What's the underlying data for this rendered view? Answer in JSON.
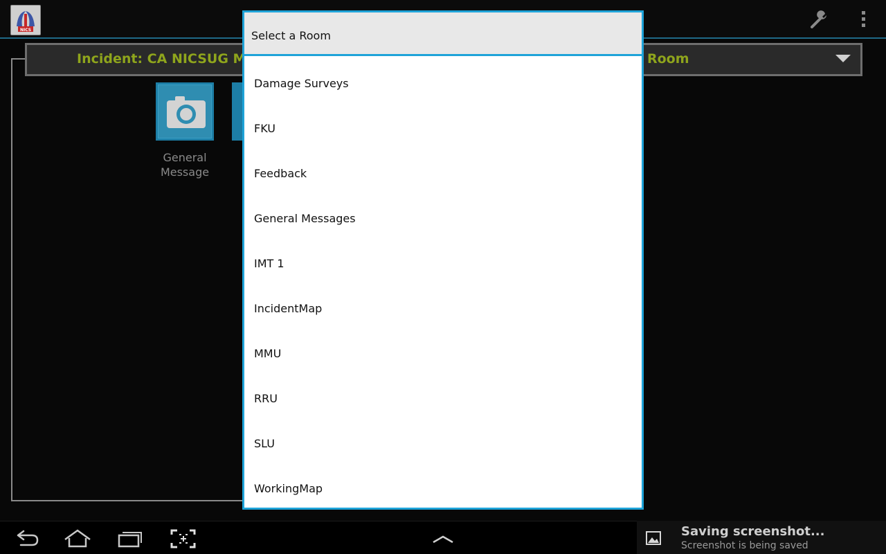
{
  "app": {
    "logo_text": "NICS"
  },
  "incident": {
    "title": "Incident: CA NICSUG Mo",
    "room_suffix": "Room"
  },
  "tiles": [
    {
      "label_line1": "General",
      "label_line2": "Message",
      "icon": "camera-icon"
    },
    {
      "label_line1": "",
      "label_line2": "",
      "icon": "tile-icon"
    }
  ],
  "dialog": {
    "title": "Select a Room",
    "rooms": [
      "Damage Surveys",
      "FKU",
      "Feedback",
      "General Messages",
      "IMT 1",
      "IncidentMap",
      "MMU",
      "RRU",
      "SLU",
      "WorkingMap"
    ]
  },
  "notification": {
    "title": "Saving screenshot...",
    "text": "Screenshot is being saved"
  },
  "colors": {
    "accent": "#1ea3d8",
    "incident_text": "#8fa51c"
  }
}
